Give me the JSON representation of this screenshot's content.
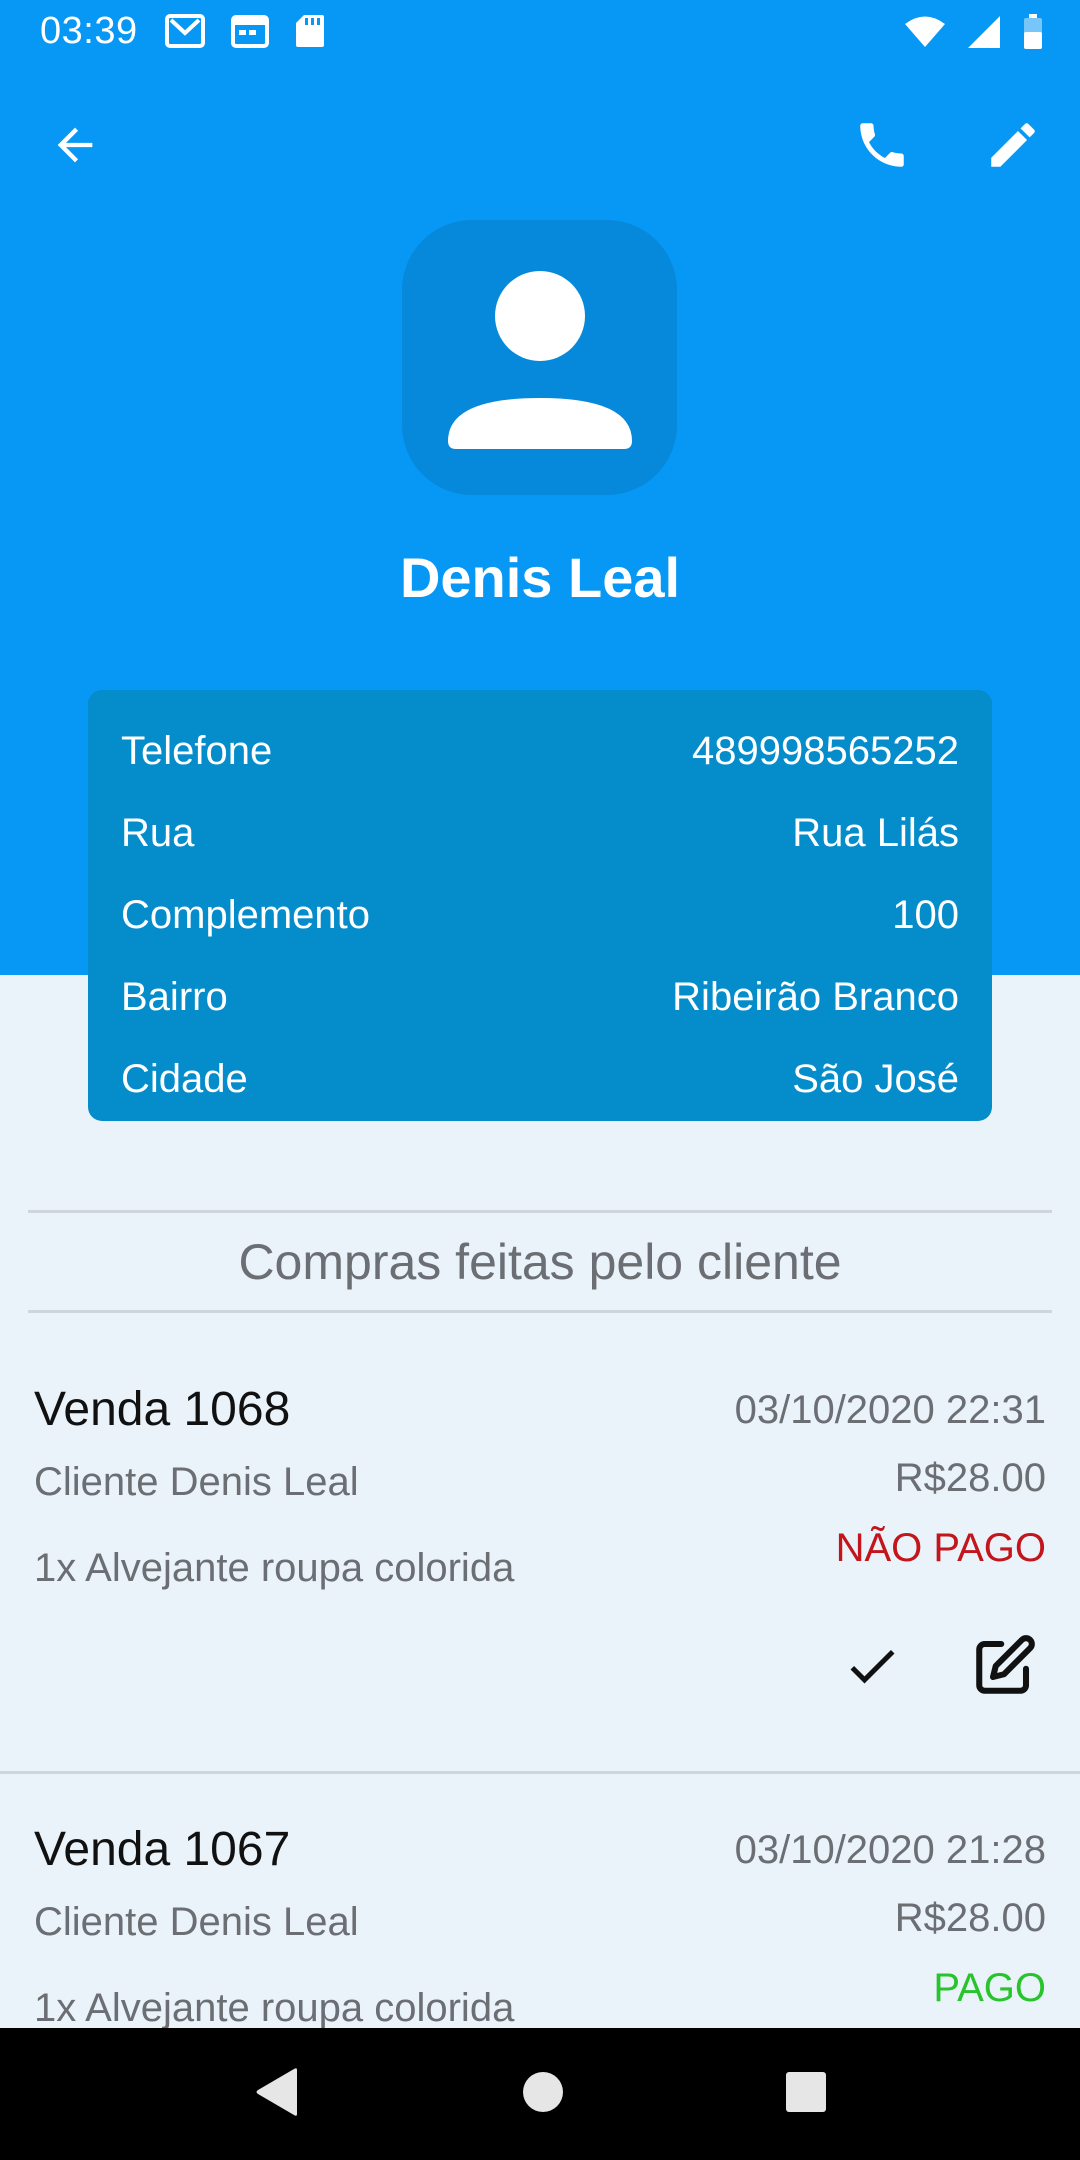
{
  "status_bar": {
    "time": "03:39",
    "left_icons": [
      "gmail-icon",
      "calendar-icon",
      "sd-card-icon"
    ],
    "right_icons": [
      "wifi-icon",
      "signal-icon",
      "battery-icon"
    ]
  },
  "toolbar": {
    "back_icon": "arrow-back-icon",
    "phone_icon": "phone-icon",
    "edit_icon": "pencil-icon"
  },
  "profile": {
    "avatar_icon": "person-icon",
    "name": "Denis Leal"
  },
  "info": [
    {
      "label": "Telefone",
      "value": "489998565252"
    },
    {
      "label": "Rua",
      "value": "Rua Lilás"
    },
    {
      "label": "Complemento",
      "value": "100"
    },
    {
      "label": "Bairro",
      "value": "Ribeirão Branco"
    },
    {
      "label": "Cidade",
      "value": "São José"
    }
  ],
  "section": {
    "title": "Compras feitas pelo cliente"
  },
  "sales": [
    {
      "title": "Venda 1068",
      "date": "03/10/2020 22:31",
      "client": "Cliente Denis Leal",
      "amount": "R$28.00",
      "items": "1x Alvejante roupa colorida",
      "status": "NÃO PAGO"
    },
    {
      "title": "Venda 1067",
      "date": "03/10/2020 21:28",
      "client": "Cliente Denis Leal",
      "amount": "R$28.00",
      "items": "1x Alvejante roupa colorida",
      "status": "PAGO"
    }
  ],
  "colors": {
    "header": "#0797f4",
    "card": "#058ccb",
    "unpaid": "#c2151c",
    "paid": "#27c42c"
  }
}
